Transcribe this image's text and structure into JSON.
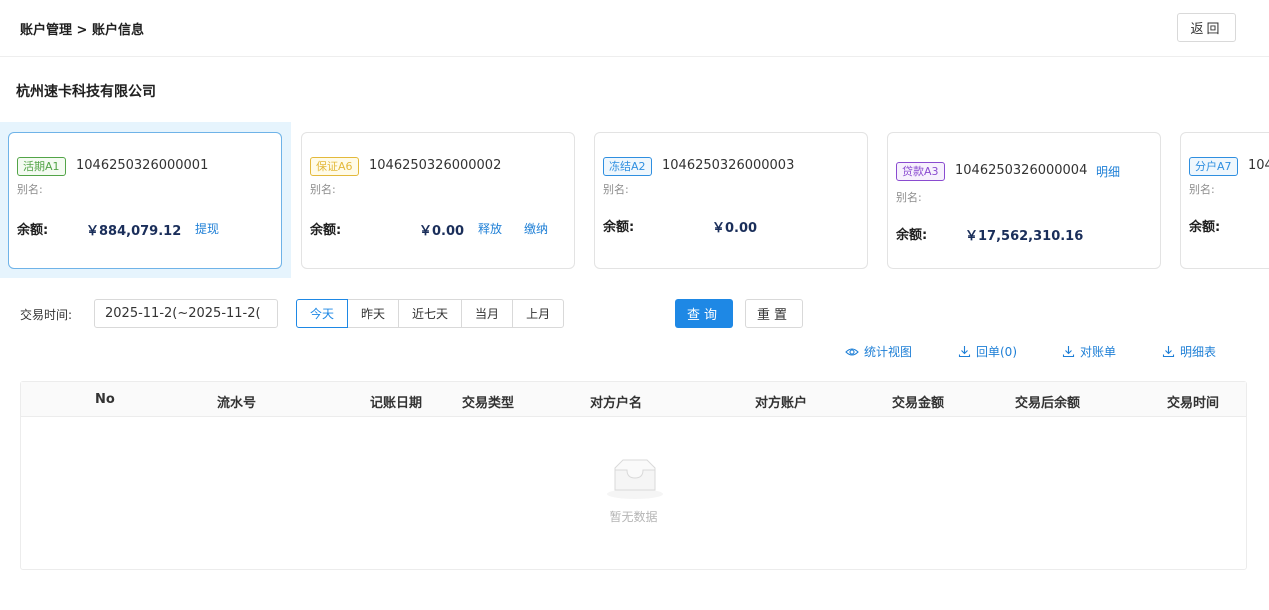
{
  "header": {
    "breadcrumb": "账户管理 > 账户信息",
    "back_label": "返回"
  },
  "company_name": "杭州速卡科技有限公司",
  "accounts": [
    {
      "tag": "活期A1",
      "number": "1046250326000001",
      "alias_label": "别名:",
      "balance_label": "余额:",
      "balance": "￥884,079.12",
      "actions": [
        "提现"
      ]
    },
    {
      "tag": "保证A6",
      "number": "1046250326000002",
      "alias_label": "别名:",
      "balance_label": "余额:",
      "balance": "￥0.00",
      "actions": [
        "释放",
        "缴纳"
      ]
    },
    {
      "tag": "冻结A2",
      "number": "1046250326000003",
      "alias_label": "别名:",
      "balance_label": "余额:",
      "balance": "￥0.00",
      "actions": []
    },
    {
      "tag": "贷款A3",
      "number": "1046250326000004",
      "alias_label": "别名:",
      "balance_label": "余额:",
      "balance": "￥17,562,310.16",
      "detail_link": "明细",
      "actions": []
    },
    {
      "tag": "分户A7",
      "number": "104",
      "alias_label": "别名:",
      "balance_label": "余额:",
      "balance": "",
      "actions": []
    }
  ],
  "filter": {
    "label": "交易时间:",
    "date_range": "2025-11-2(~2025-11-2(",
    "quick_options": [
      "今天",
      "昨天",
      "近七天",
      "当月",
      "上月"
    ],
    "active_option": "今天",
    "query_label": "查询",
    "reset_label": "重置"
  },
  "tools": [
    {
      "icon": "eye-icon",
      "label": "统计视图"
    },
    {
      "icon": "download-icon",
      "label": "回单(0)"
    },
    {
      "icon": "download-icon",
      "label": "对账单"
    },
    {
      "icon": "download-icon",
      "label": "明细表"
    }
  ],
  "table": {
    "columns": [
      "No",
      "流水号",
      "记账日期",
      "交易类型",
      "对方户名",
      "对方账户",
      "交易金额",
      "交易后余额",
      "交易时间"
    ],
    "rows": [],
    "empty_text": "暂无数据"
  },
  "colors": {
    "primary": "#1e88e5",
    "link": "#1e7fd6",
    "balance": "#1a2e5a",
    "selected_card_bg": "#e6f4fd"
  }
}
